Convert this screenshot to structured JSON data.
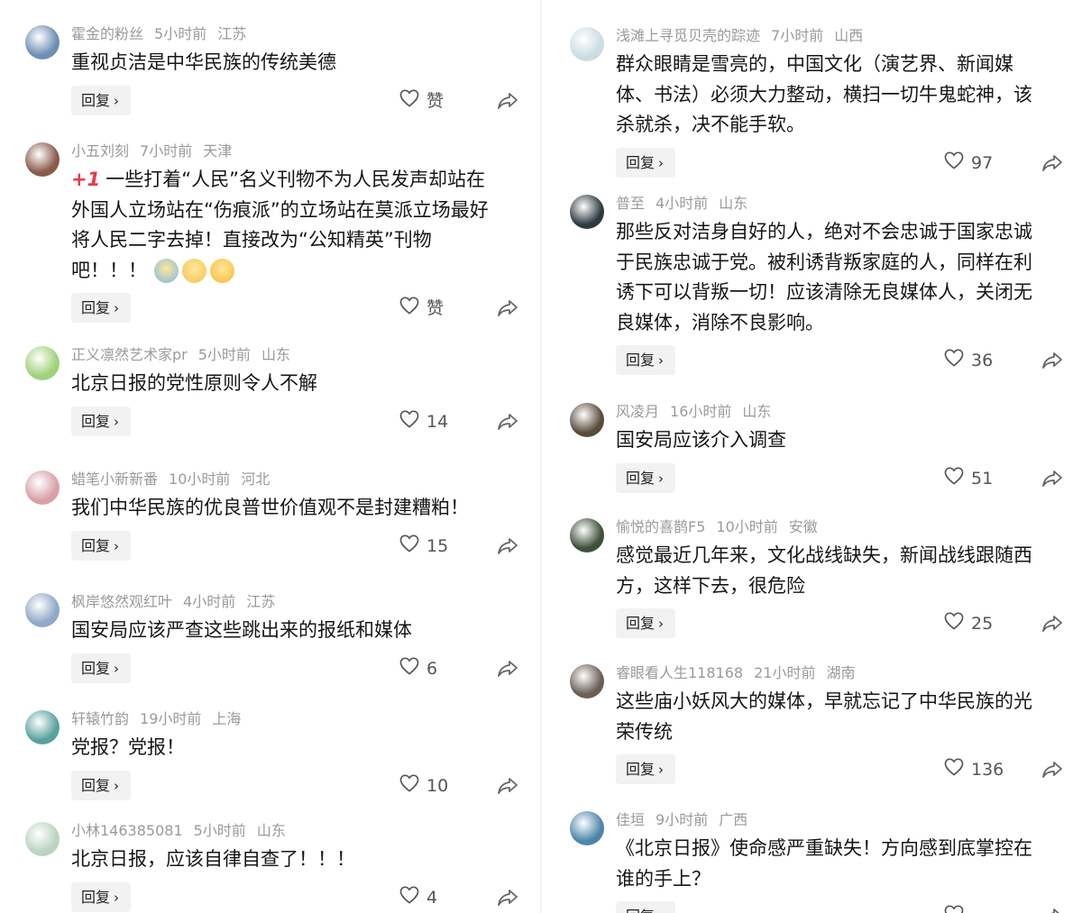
{
  "left": [
    {
      "user": "霍金的粉丝",
      "time": "5小时前",
      "loc": "江苏",
      "lines": [
        "重视贞洁是中华民族的传统美德"
      ],
      "reply": "回复",
      "like": "赞",
      "avatar_color": "#6d8fb5"
    },
    {
      "user": "小五刘刻",
      "time": "7小时前",
      "loc": "天津",
      "prefix": "+1",
      "lines": [
        "一些打着“人民”名义刊物不为人民发声却站在",
        "外国人立场站在“伤痕派”的立场站在莫派立场最好",
        "将人民二字去掉！直接改为“公知精英”刊物",
        "吧！！！"
      ],
      "emoji": [
        "laugh-emoji",
        "smirk-emoji",
        "shock-emoji"
      ],
      "reply": "回复",
      "like": "赞",
      "avatar_color": "#8a5a4a"
    },
    {
      "user": "正义凛然艺术家pr",
      "time": "5小时前",
      "loc": "山东",
      "lines": [
        "北京日报的党性原则令人不解"
      ],
      "reply": "回复",
      "like": "14",
      "avatar_color": "#9fd17a"
    },
    {
      "user": "蜡笔小新新番",
      "time": "10小时前",
      "loc": "河北",
      "lines": [
        "我们中华民族的优良普世价值观不是封建糟粕！"
      ],
      "reply": "回复",
      "like": "15",
      "avatar_color": "#d8a0a8"
    },
    {
      "user": "枫岸悠然观红叶",
      "time": "4小时前",
      "loc": "江苏",
      "lines": [
        "国安局应该严查这些跳出来的报纸和媒体"
      ],
      "reply": "回复",
      "like": "6",
      "avatar_color": "#8fa8c8"
    },
    {
      "user": "轩辕竹韵",
      "time": "19小时前",
      "loc": "上海",
      "lines": [
        "党报？党报！"
      ],
      "reply": "回复",
      "like": "10",
      "avatar_color": "#5aa0a0"
    },
    {
      "user": "小林146385081",
      "time": "5小时前",
      "loc": "山东",
      "lines": [
        "北京日报，应该自律自查了！！！"
      ],
      "reply": "回复",
      "like": "4",
      "avatar_color": "#b9d4c0"
    }
  ],
  "right": [
    {
      "user": "浅滩上寻觅贝壳的踪迹",
      "time": "7小时前",
      "loc": "山西",
      "lines": [
        "群众眼睛是雪亮的，中国文化（演艺界、新闻媒",
        "体、书法）必须大力整动，横扫一切牛鬼蛇神，该",
        "杀就杀，决不能手软。"
      ],
      "reply": "回复",
      "like": "97",
      "avatar_color": "#c9dde3"
    },
    {
      "user": "普至",
      "time": "4小时前",
      "loc": "山东",
      "lines": [
        "那些反对洁身自好的人，绝对不会忠诚于国家忠诚",
        "于民族忠诚于党。被利诱背叛家庭的人，同样在利",
        "诱下可以背叛一切！应该清除无良媒体人，关闭无",
        "良媒体，消除不良影响。"
      ],
      "reply": "回复",
      "like": "36",
      "avatar_color": "#2f3a3f"
    },
    {
      "user": "风凌月",
      "time": "16小时前",
      "loc": "山东",
      "lines": [
        "国安局应该介入调查"
      ],
      "reply": "回复",
      "like": "51",
      "avatar_color": "#5a4a3c"
    },
    {
      "user": "愉悦的喜鹊F5",
      "time": "10小时前",
      "loc": "安徽",
      "lines": [
        "感觉最近几年来，文化战线缺失，新闻战线跟随西",
        "方，这样下去，很危险"
      ],
      "reply": "回复",
      "like": "25",
      "avatar_color": "#3f4f3a"
    },
    {
      "user": "睿眼看人生118168",
      "time": "21小时前",
      "loc": "湖南",
      "lines": [
        "这些庙小妖风大的媒体，早就忘记了中华民族的光",
        "荣传统"
      ],
      "reply": "回复",
      "like": "136",
      "avatar_color": "#6a5e55"
    },
    {
      "user": "佳垣",
      "time": "9小时前",
      "loc": "广西",
      "lines": [
        "《北京日报》使命感严重缺失！方向感到底掌控在",
        "谁的手上？"
      ],
      "reply": "回复",
      "like": "",
      "avatar_color": "#4d86a8"
    }
  ]
}
